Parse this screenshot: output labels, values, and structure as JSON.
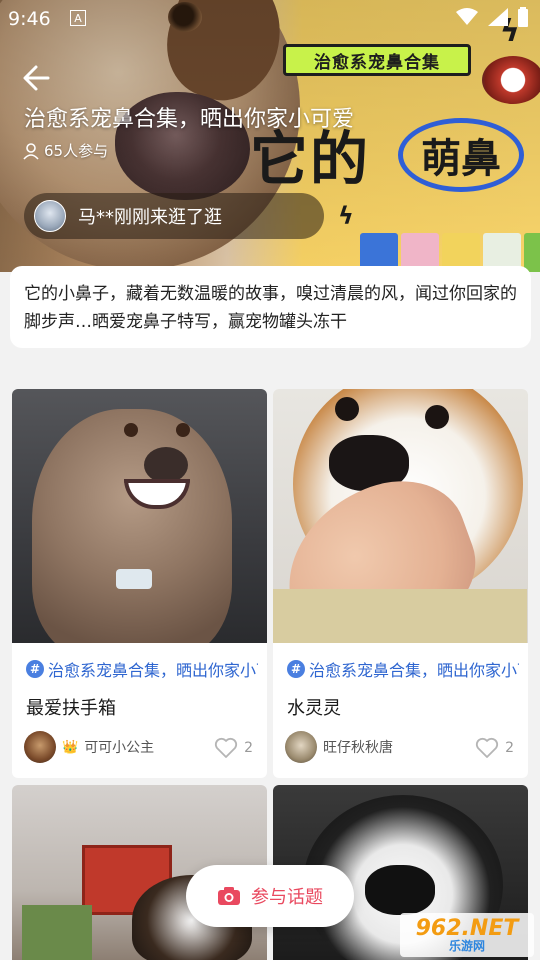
{
  "status_bar": {
    "time": "9:46",
    "notif_icon": "A"
  },
  "hero": {
    "banner_tag": "治愈系宠鼻合集",
    "banner_big": "它的",
    "banner_circle": "萌鼻",
    "title": "治愈系宠鼻合集，晒出你家小可爱",
    "participants": "65人参与",
    "visitor_text": "马**刚刚来逛了逛"
  },
  "description": "它的小鼻子，藏着无数温暖的故事，嗅过清晨的风，闻过你回家的脚步声…晒爱宠鼻子特写，赢宠物罐头冻干",
  "posts": [
    {
      "topic": "治愈系宠鼻合集，晒出你家小可爱",
      "title": "最爱扶手箱",
      "author": "可可小公主",
      "crown": "👑",
      "likes": "2"
    },
    {
      "topic": "治愈系宠鼻合集，晒出你家小可爱",
      "title": "水灵灵",
      "author": "旺仔秋秋唐",
      "likes": "2"
    }
  ],
  "join_button": {
    "label": "参与话题"
  },
  "watermark": {
    "top": "962.NET",
    "bottom": "乐游网"
  },
  "colors": {
    "accent": "#e9495f",
    "topic_blue": "#2f66d0",
    "banner_green": "#c8f24a",
    "banner_yellow": "#f8d46a"
  }
}
